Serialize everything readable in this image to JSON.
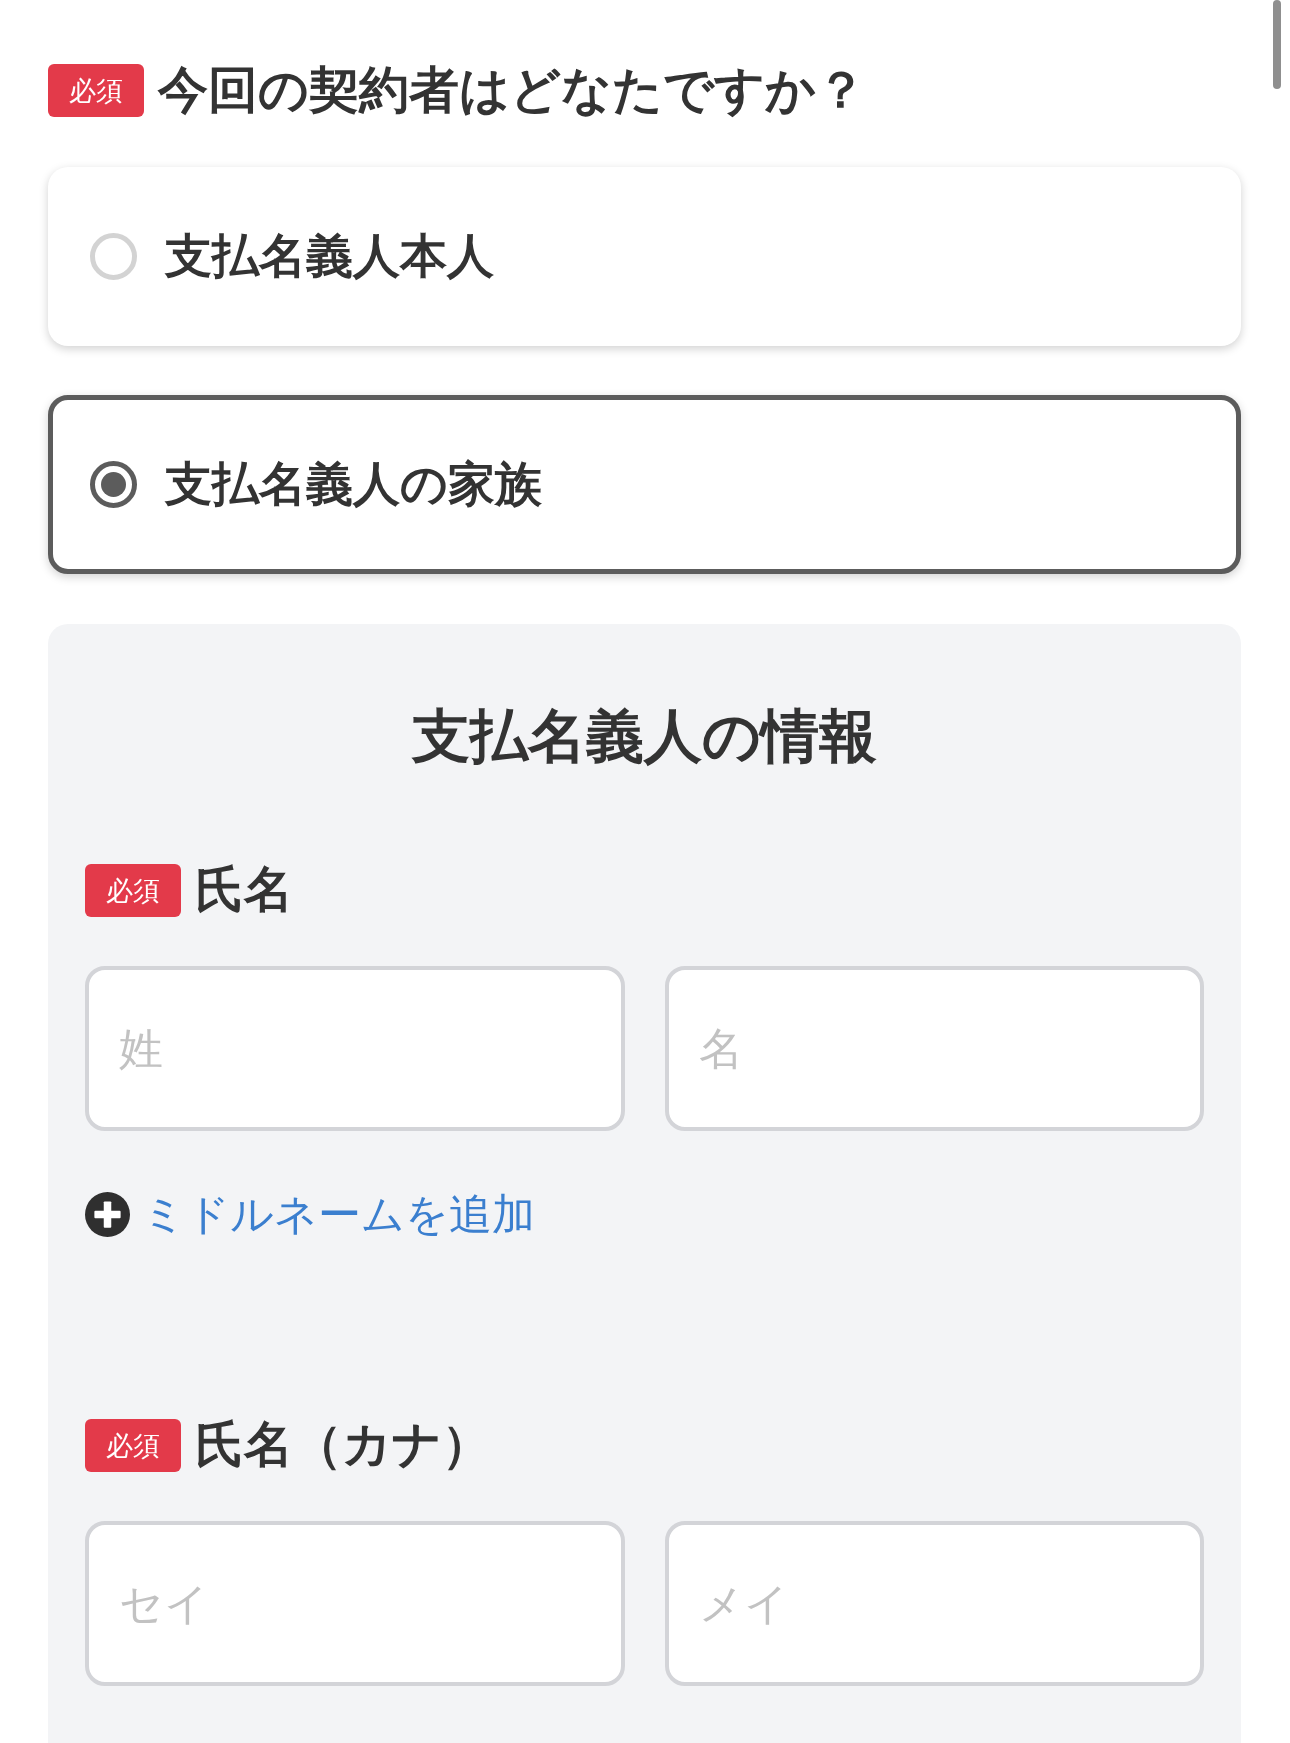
{
  "question": {
    "badge": "必須",
    "title": "今回の契約者はどなたですか？"
  },
  "options": [
    {
      "label": "支払名義人本人",
      "selected": false
    },
    {
      "label": "支払名義人の家族",
      "selected": true
    }
  ],
  "payer_info": {
    "title": "支払名義人の情報",
    "fields": [
      {
        "badge": "必須",
        "label": "氏名",
        "inputs": [
          {
            "placeholder": "姓"
          },
          {
            "placeholder": "名"
          }
        ],
        "add_link": "ミドルネームを追加"
      },
      {
        "badge": "必須",
        "label": "氏名（カナ）",
        "inputs": [
          {
            "placeholder": "セイ"
          },
          {
            "placeholder": "メイ"
          }
        ]
      }
    ]
  }
}
